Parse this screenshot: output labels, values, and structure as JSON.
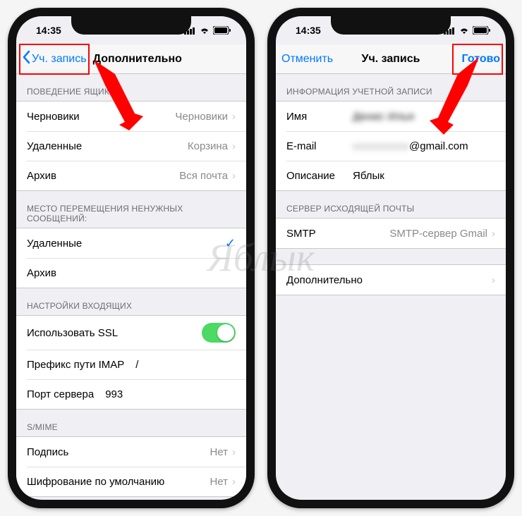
{
  "statusbar": {
    "time": "14:35"
  },
  "left_phone": {
    "nav": {
      "back": "Уч. запись",
      "title": "Дополнительно"
    },
    "sections": {
      "mailbox_behaviors": {
        "header": "ПОВЕДЕНИЕ ЯЩИК",
        "drafts_label": "Черновики",
        "drafts_value": "Черновики",
        "deleted_label": "Удаленные",
        "deleted_value": "Корзина",
        "archive_label": "Архив",
        "archive_value": "Вся почта"
      },
      "move_discarded": {
        "header": "МЕСТО ПЕРЕМЕЩЕНИЯ НЕНУЖНЫХ СООБЩЕНИЙ:",
        "deleted": "Удаленные",
        "archive": "Архив"
      },
      "incoming": {
        "header": "НАСТРОЙКИ ВХОДЯЩИХ",
        "ssl": "Использовать SSL",
        "imap_prefix_label": "Префикс пути IMAP",
        "imap_prefix_value": "/",
        "port_label": "Порт сервера",
        "port_value": "993"
      },
      "smime": {
        "header": "S/MIME",
        "sign_label": "Подпись",
        "sign_value": "Нет",
        "encrypt_label": "Шифрование по умолчанию",
        "encrypt_value": "Нет"
      }
    }
  },
  "right_phone": {
    "nav": {
      "cancel": "Отменить",
      "title": "Уч. запись",
      "done": "Готово"
    },
    "sections": {
      "account_info": {
        "header": "ИНФОРМАЦИЯ УЧЕТНОЙ ЗАПИСИ",
        "name_label": "Имя",
        "name_value": "Денис Илья",
        "email_label": "E-mail",
        "email_value_hidden": "xxxxxxxxxx",
        "email_domain": "@gmail.com",
        "desc_label": "Описание",
        "desc_value": "Яблык"
      },
      "outgoing": {
        "header": "СЕРВЕР ИСХОДЯЩЕЙ ПОЧТЫ",
        "smtp_label": "SMTP",
        "smtp_value": "SMTP-сервер Gmail"
      },
      "advanced": {
        "label": "Дополнительно"
      }
    }
  },
  "watermark": "Яблык"
}
